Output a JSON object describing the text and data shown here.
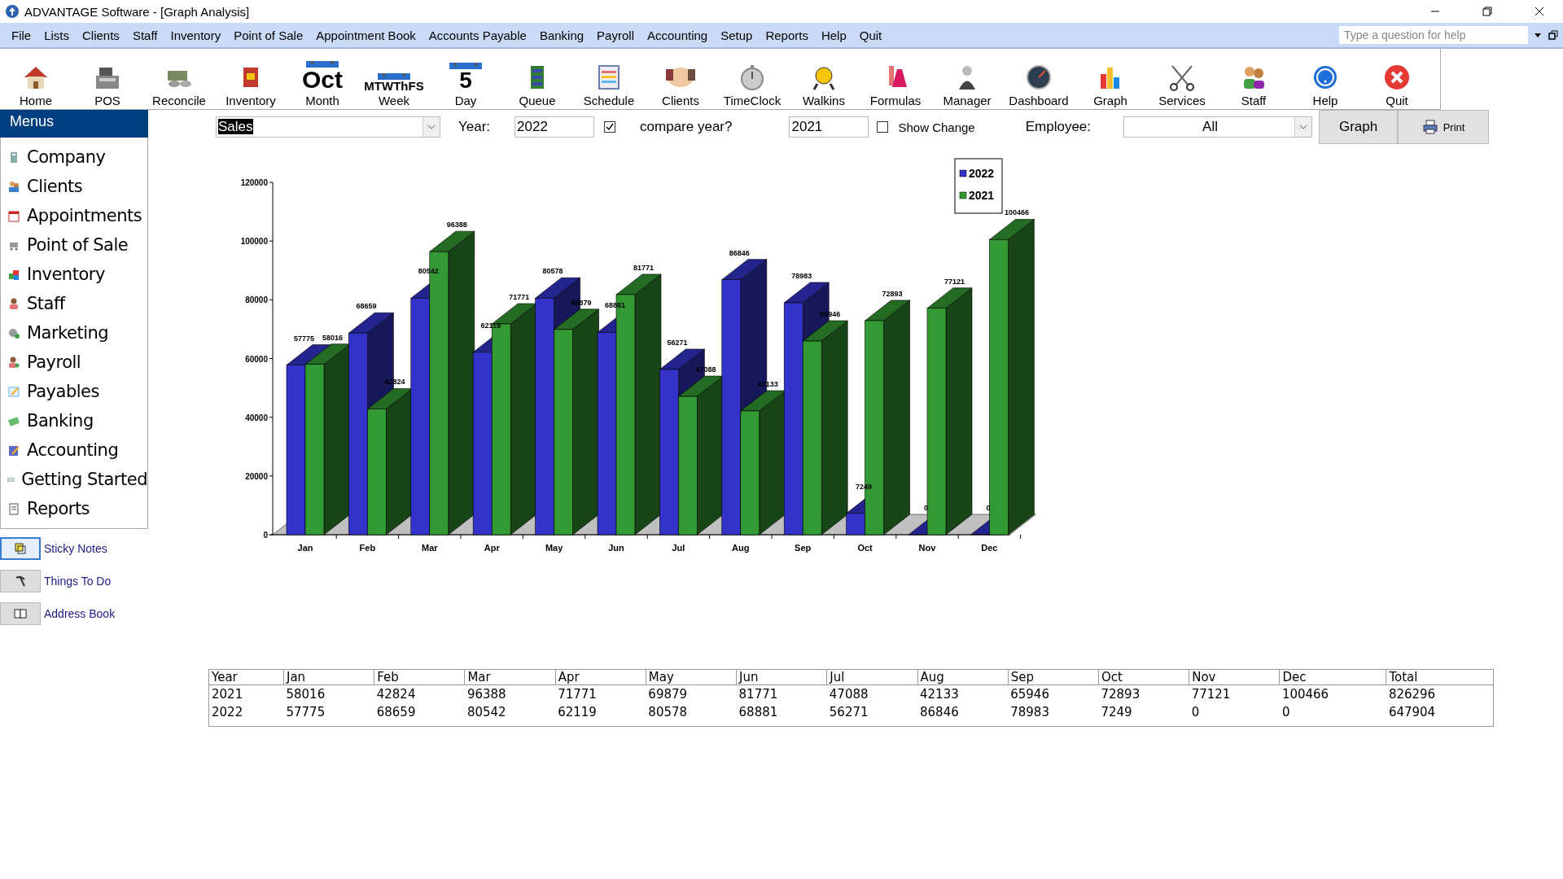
{
  "window": {
    "title": "ADVANTAGE Software - [Graph Analysis]"
  },
  "menu_bar": [
    "File",
    "Lists",
    "Clients",
    "Staff",
    "Inventory",
    "Point of Sale",
    "Appointment Book",
    "Accounts Payable",
    "Banking",
    "Payroll",
    "Accounting",
    "Setup",
    "Reports",
    "Help",
    "Quit"
  ],
  "help_search": {
    "placeholder": "Type a question for help"
  },
  "toolbar": [
    {
      "label": "Home",
      "kind": "icon"
    },
    {
      "label": "POS",
      "kind": "icon"
    },
    {
      "label": "Reconcile",
      "kind": "icon"
    },
    {
      "label": "Inventory",
      "kind": "icon"
    },
    {
      "label": "Month",
      "kind": "calendar",
      "icon_text": "Oct"
    },
    {
      "label": "Week",
      "kind": "calendar",
      "icon_text": "MTWThFS"
    },
    {
      "label": "Day",
      "kind": "calendar",
      "icon_text": "5"
    },
    {
      "label": "Queue",
      "kind": "icon"
    },
    {
      "label": "Schedule",
      "kind": "icon"
    },
    {
      "label": "Clients",
      "kind": "icon"
    },
    {
      "label": "TimeClock",
      "kind": "icon"
    },
    {
      "label": "Walkins",
      "kind": "icon"
    },
    {
      "label": "Formulas",
      "kind": "icon"
    },
    {
      "label": "Manager",
      "kind": "icon"
    },
    {
      "label": "Dashboard",
      "kind": "icon"
    },
    {
      "label": "Graph",
      "kind": "icon"
    },
    {
      "label": "Services",
      "kind": "icon"
    },
    {
      "label": "Staff",
      "kind": "icon"
    },
    {
      "label": "Help",
      "kind": "icon"
    },
    {
      "label": "Quit",
      "kind": "icon"
    }
  ],
  "sidebar": {
    "title": "Menus",
    "items": [
      "Company",
      "Clients",
      "Appointments",
      "Point of Sale",
      "Inventory",
      "Staff",
      "Marketing",
      "Payroll",
      "Payables",
      "Banking",
      "Accounting",
      "Getting Started",
      "Reports"
    ],
    "links": [
      "Sticky Notes",
      "Things To Do",
      "Address Book"
    ]
  },
  "controls": {
    "report": "Sales",
    "year_label": "Year:",
    "year": "2022",
    "compare_checked": true,
    "compare_label": "compare year?",
    "compare_year": "2021",
    "show_change_checked": false,
    "show_change_label": "Show Change",
    "employee_label": "Employee:",
    "employee": "All",
    "graph_button": "Graph",
    "print_button": "Print"
  },
  "chart_data": {
    "type": "bar",
    "categories": [
      "Jan",
      "Feb",
      "Mar",
      "Apr",
      "May",
      "Jun",
      "Jul",
      "Aug",
      "Sep",
      "Oct",
      "Nov",
      "Dec"
    ],
    "series": [
      {
        "name": "2022",
        "color": "#3333cc",
        "values": [
          57775,
          68659,
          80542,
          62119,
          80578,
          68881,
          56271,
          86846,
          78983,
          7249,
          0,
          0
        ]
      },
      {
        "name": "2021",
        "color": "#339933",
        "values": [
          58016,
          42824,
          96388,
          71771,
          69879,
          81771,
          47088,
          42133,
          65946,
          72893,
          77121,
          100466
        ]
      }
    ],
    "legend": "upper right",
    "ylim": [
      0,
      120000
    ],
    "yticks": [
      0,
      20000,
      40000,
      60000,
      80000,
      100000,
      120000
    ],
    "data_labels": true
  },
  "table": {
    "columns": [
      "Year",
      "Jan",
      "Feb",
      "Mar",
      "Apr",
      "May",
      "Jun",
      "Jul",
      "Aug",
      "Sep",
      "Oct",
      "Nov",
      "Dec",
      "Total"
    ],
    "rows": [
      [
        "2021",
        "58016",
        "42824",
        "96388",
        "71771",
        "69879",
        "81771",
        "47088",
        "42133",
        "65946",
        "72893",
        "77121",
        "100466",
        "826296"
      ],
      [
        "2022",
        "57775",
        "68659",
        "80542",
        "62119",
        "80578",
        "68881",
        "56271",
        "86846",
        "78983",
        "7249",
        "0",
        "0",
        "647904"
      ]
    ]
  }
}
